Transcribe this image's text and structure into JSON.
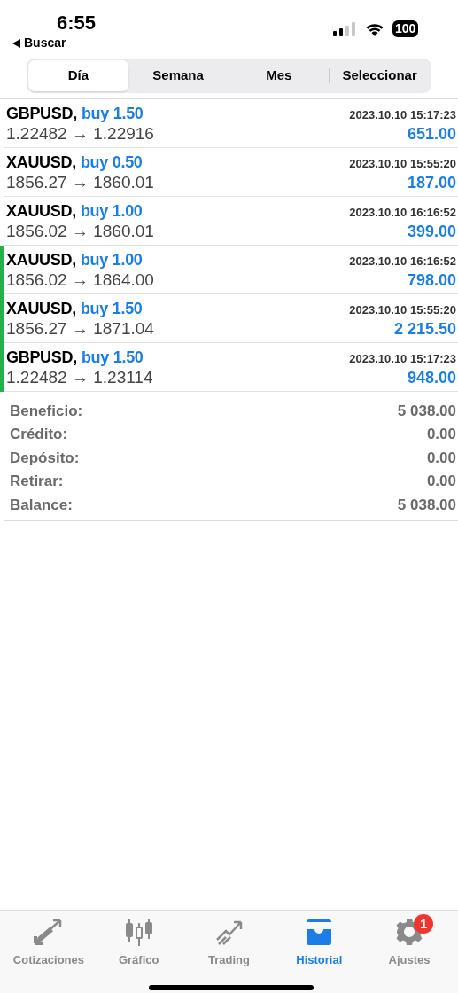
{
  "status_bar": {
    "time": "6:55",
    "back_label": "Buscar",
    "battery": "100"
  },
  "segments": [
    {
      "label": "Día",
      "selected": true
    },
    {
      "label": "Semana",
      "selected": false
    },
    {
      "label": "Mes",
      "selected": false
    },
    {
      "label": "Seleccionar",
      "selected": false
    }
  ],
  "deals": [
    {
      "symbol": "GBPUSD,",
      "action": "buy 1.50",
      "time": "2023.10.10 15:17:23",
      "prices": "1.22482 → 1.22916",
      "profit": "651.00",
      "marked": false
    },
    {
      "symbol": "XAUUSD,",
      "action": "buy 0.50",
      "time": "2023.10.10 15:55:20",
      "prices": "1856.27 → 1860.01",
      "profit": "187.00",
      "marked": false
    },
    {
      "symbol": "XAUUSD,",
      "action": "buy 1.00",
      "time": "2023.10.10 16:16:52",
      "prices": "1856.02 → 1860.01",
      "profit": "399.00",
      "marked": false
    },
    {
      "symbol": "XAUUSD,",
      "action": "buy 1.00",
      "time": "2023.10.10 16:16:52",
      "prices": "1856.02 → 1864.00",
      "profit": "798.00",
      "marked": true
    },
    {
      "symbol": "XAUUSD,",
      "action": "buy 1.50",
      "time": "2023.10.10 15:55:20",
      "prices": "1856.27 → 1871.04",
      "profit": "2 215.50",
      "marked": true
    },
    {
      "symbol": "GBPUSD,",
      "action": "buy 1.50",
      "time": "2023.10.10 15:17:23",
      "prices": "1.22482 → 1.23114",
      "profit": "948.00",
      "marked": true
    }
  ],
  "summary": [
    {
      "label": "Beneficio:",
      "value": "5 038.00"
    },
    {
      "label": "Crédito:",
      "value": "0.00"
    },
    {
      "label": "Depósito:",
      "value": "0.00"
    },
    {
      "label": "Retirar:",
      "value": "0.00"
    },
    {
      "label": "Balance:",
      "value": "5 038.00"
    }
  ],
  "tab_bar": [
    {
      "kind": "quotes",
      "label": "Cotizaciones",
      "selected": false
    },
    {
      "kind": "chart",
      "label": "Gráfico",
      "selected": false
    },
    {
      "kind": "trading",
      "label": "Trading",
      "selected": false
    },
    {
      "kind": "history",
      "label": "Historial",
      "selected": true
    },
    {
      "kind": "settings",
      "label": "Ajustes",
      "selected": false,
      "badge": "1"
    }
  ]
}
